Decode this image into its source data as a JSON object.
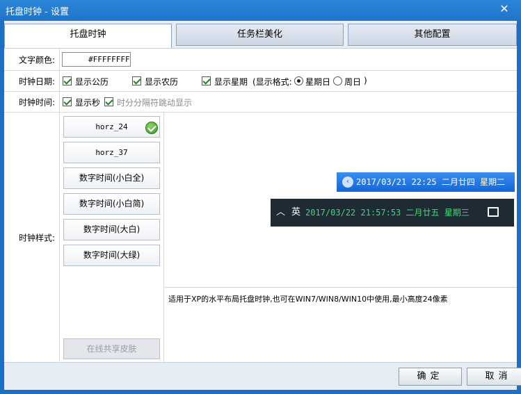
{
  "window": {
    "title": "托盘时钟 - 设置",
    "close_glyph": "✕"
  },
  "tabs": [
    {
      "label": "托盘时钟",
      "active": true
    },
    {
      "label": "任务栏美化",
      "active": false
    },
    {
      "label": "其他配置",
      "active": false
    }
  ],
  "text_color": {
    "label": "文字颜色:",
    "value": "#FFFFFFFF"
  },
  "clock_date": {
    "label": "时钟日期:",
    "show_gregorian": "显示公历",
    "show_lunar": "显示农历",
    "show_weekday": "显示星期",
    "format_prefix": "(显示格式:",
    "format_option_1": "星期日",
    "format_option_2": "周日",
    "format_suffix": ")",
    "selected_format": "星期日"
  },
  "clock_time": {
    "label": "时钟时间:",
    "show_seconds": "显示秒",
    "blink_separator": "时分分隔符跳动显示"
  },
  "clock_style": {
    "label": "时钟样式:",
    "options": [
      "horz_24",
      "horz_37",
      "数字时间(小白全)",
      "数字时间(小白简)",
      "数字时间(大白)",
      "数字时间(大绿)"
    ],
    "selected": "horz_24",
    "share_button": "在线共享皮肤"
  },
  "preview": {
    "bar1_text": "2017/03/21 22:25 二月廿四 星期二",
    "bar1_arrow": "‹",
    "bar2_up": "︿",
    "bar2_ime": "英",
    "bar2_text": "2017/03/22 21:57:53 二月廿五 星期三",
    "bar1_color": "#1f6fe0",
    "bar2_text_color": "#41d97a"
  },
  "description": "适用于XP的水平布局托盘时钟,也可在WIN7/WIN8/WIN10中使用,最小高度24像素",
  "buttons": {
    "ok": "确定",
    "cancel": "取消"
  }
}
